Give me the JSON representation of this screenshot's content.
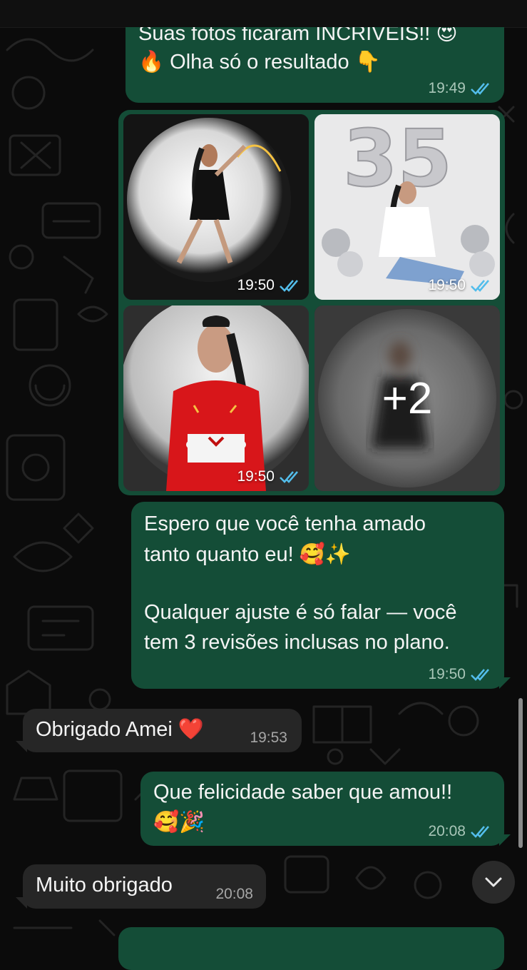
{
  "colors": {
    "outgoing_bubble": "#144d37",
    "incoming_bubble": "#262626",
    "read_ticks": "#53bdeb",
    "background": "#0b0b0b"
  },
  "header": {
    "avatar": "contact-avatar",
    "back_icon": "chevron-left-icon",
    "video_icon": "video-call-icon",
    "call_icon": "phone-icon"
  },
  "messages": {
    "m1": {
      "line1": "Suas fotos ficaram INCRÍVEIS!! 😍",
      "line2": "🔥 Olha só o resultado 👇",
      "time": "19:49",
      "status": "read"
    },
    "album": {
      "photos": [
        {
          "time": "19:50",
          "status": "read",
          "subject": "woman in black dress with sparkler"
        },
        {
          "time": "19:50",
          "status": "read",
          "subject": "woman with silver 35 balloons"
        },
        {
          "time": "19:50",
          "status": "read",
          "subject": "woman in red dress holding cake"
        },
        {
          "subject": "blurred preview"
        }
      ],
      "more_count": "+2"
    },
    "m2": {
      "line1": "Espero que você tenha amado",
      "line2": "tanto quanto eu! 🥰✨",
      "line3": "Qualquer ajuste é só falar — você",
      "line4": "tem 3 revisões inclusas no plano.",
      "time": "19:50",
      "status": "read"
    },
    "m3": {
      "text": "Obrigado Amei ❤️",
      "time": "19:53"
    },
    "m4": {
      "line1": "Que felicidade saber que amou!!",
      "line2": "🥰🎉",
      "time": "20:08",
      "status": "read"
    },
    "m5": {
      "text": "Muito obrigado",
      "time": "20:08"
    }
  },
  "scroll_down_icon": "chevron-down-icon"
}
